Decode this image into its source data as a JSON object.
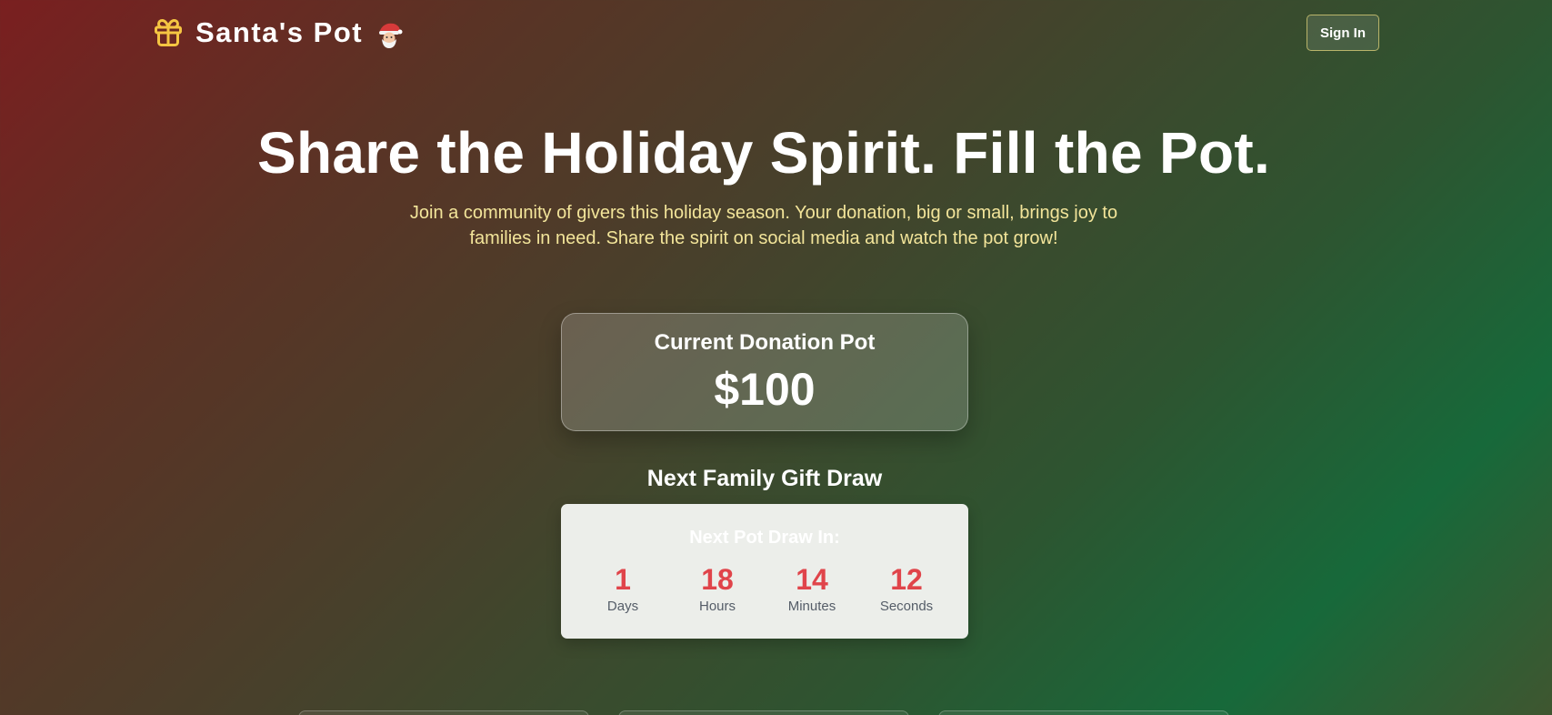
{
  "header": {
    "logo_text": "Santa's Pot",
    "logo_icon": "gift-icon",
    "logo_emoji": "santa-emoji",
    "signin_label": "Sign In"
  },
  "hero": {
    "title": "Share the Holiday Spirit. Fill the Pot.",
    "subtitle": "Join a community of givers this holiday season. Your donation, big or small, brings joy to families in need. Share the spirit on social media and watch the pot grow!"
  },
  "pot": {
    "label": "Current Donation Pot",
    "amount": "$100"
  },
  "draw": {
    "heading": "Next Family Gift Draw",
    "countdown_title": "Next Pot Draw In:",
    "units": [
      {
        "value": "1",
        "label": "Days"
      },
      {
        "value": "18",
        "label": "Hours"
      },
      {
        "value": "14",
        "label": "Minutes"
      },
      {
        "value": "12",
        "label": "Seconds"
      }
    ]
  },
  "colors": {
    "accent_red": "#e0444a",
    "gift_yellow": "#f5c542",
    "subtitle_yellow": "#f3e59a"
  }
}
